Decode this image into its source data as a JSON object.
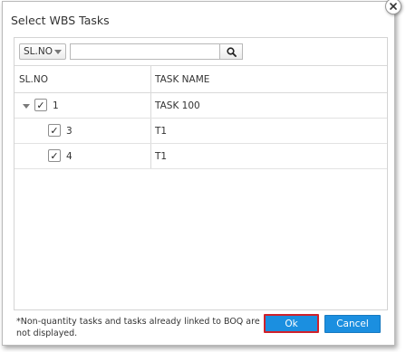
{
  "dialog": {
    "title": "Select WBS Tasks",
    "close_icon": "close-icon"
  },
  "toolbar": {
    "filter_selected": "SL.NO",
    "search_placeholder": "",
    "search_icon": "search-icon"
  },
  "table": {
    "columns": [
      "SL.NO",
      "TASK NAME"
    ],
    "rows": [
      {
        "sl_no": "1",
        "task_name": "TASK 100",
        "checked": true,
        "expanded": true,
        "level": 0
      },
      {
        "sl_no": "3",
        "task_name": "T1",
        "checked": true,
        "level": 1
      },
      {
        "sl_no": "4",
        "task_name": "T1",
        "checked": true,
        "level": 1
      }
    ],
    "check_mark": "✓"
  },
  "footer": {
    "note": "*Non-quantity tasks and tasks already linked to BOQ are not displayed.",
    "ok_label": "Ok",
    "cancel_label": "Cancel"
  },
  "colors": {
    "button_primary": "#1b8fe0",
    "focus_outline": "#d0212b"
  }
}
